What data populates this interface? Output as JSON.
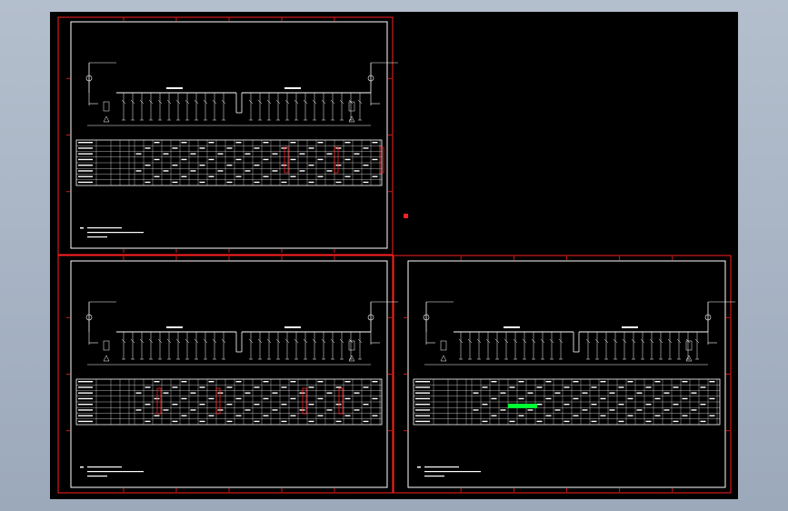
{
  "app": {
    "view": "cad-model-space"
  },
  "colors": {
    "background": "#000000",
    "frame": "#ff2020",
    "linework": "#ffffff",
    "highlight": "#00ff33",
    "window": "#a8b4c4"
  },
  "sheets": [
    {
      "id": "top-left",
      "highlight_marks": true
    },
    {
      "id": "bottom-left",
      "highlight_marks": true
    },
    {
      "id": "bottom-right",
      "green_selection": true
    }
  ]
}
